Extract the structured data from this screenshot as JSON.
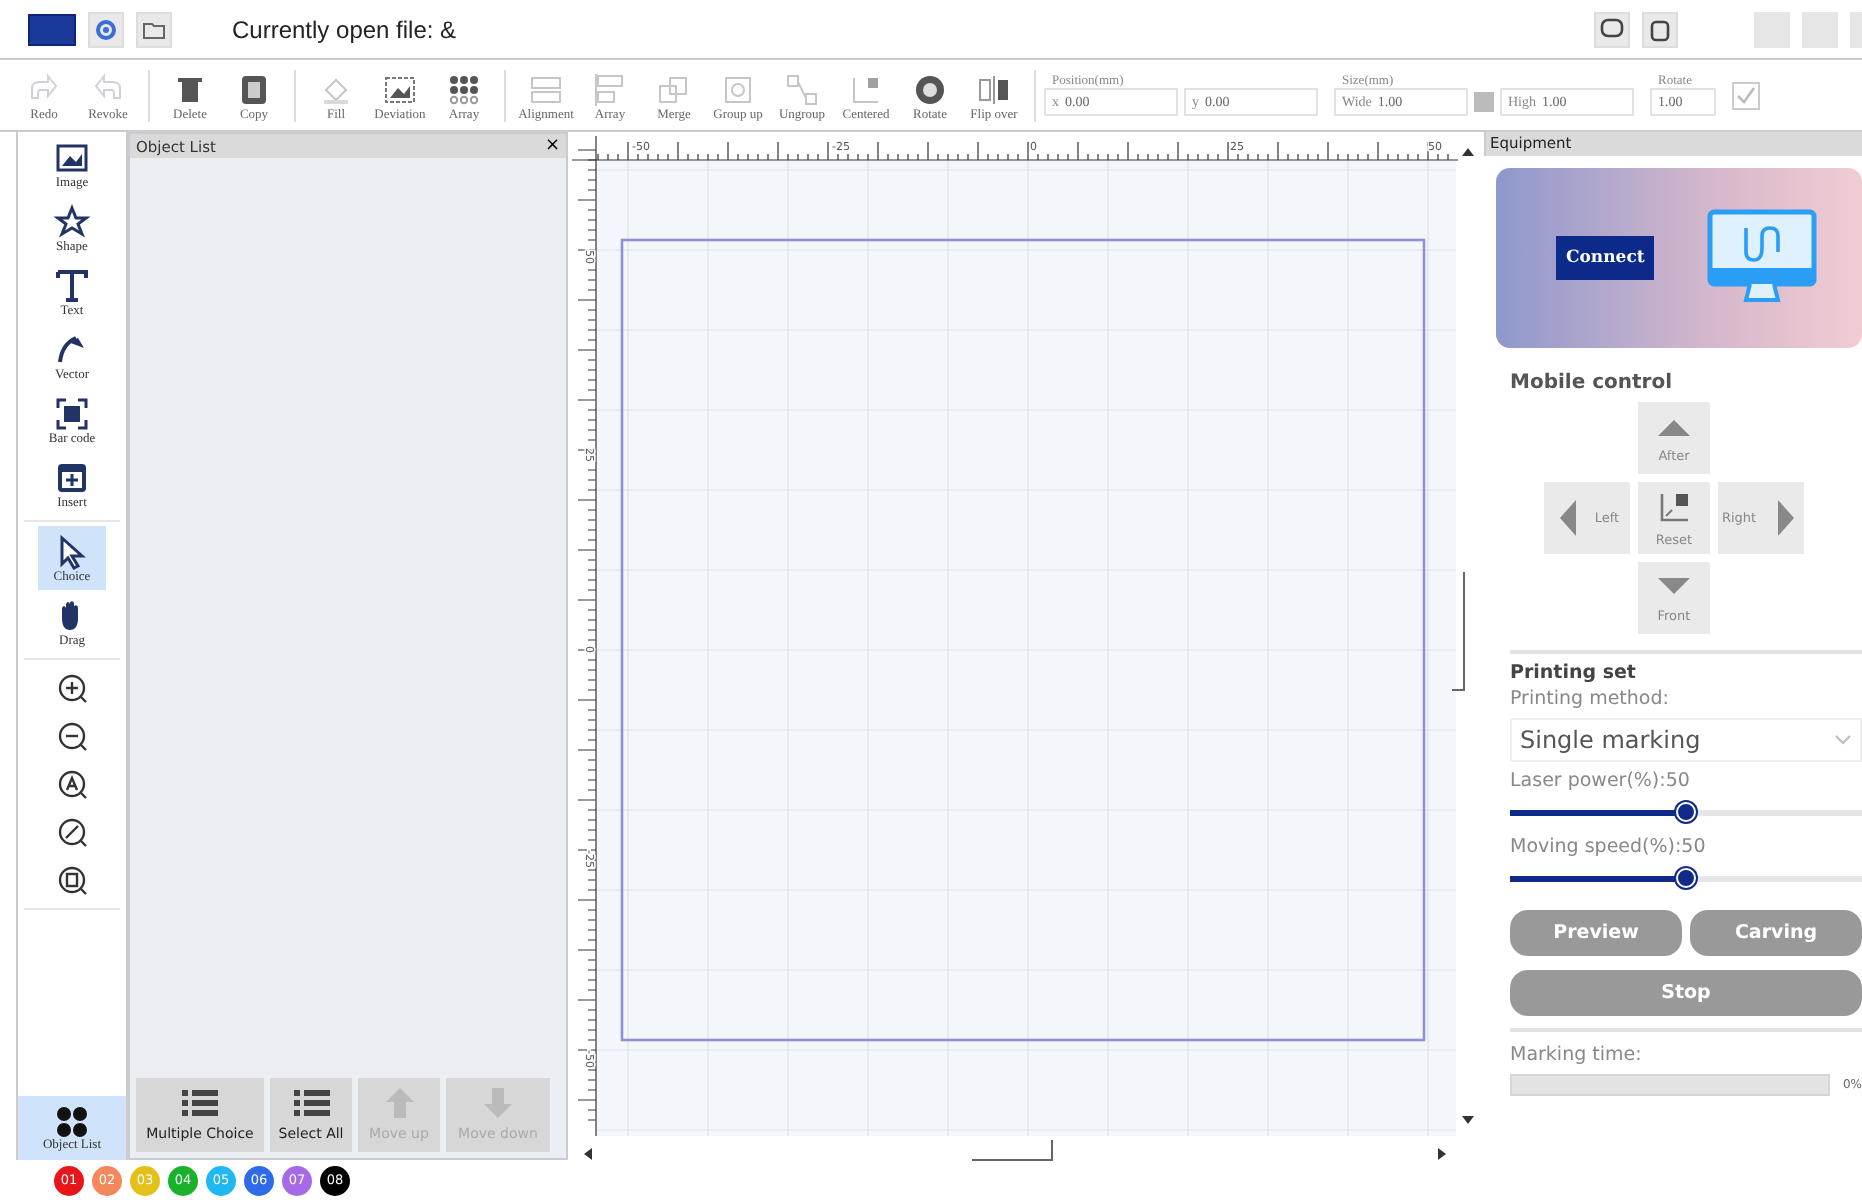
{
  "title_bar": {
    "title": "Currently open file: &"
  },
  "toolbar": {
    "groups": [
      [
        {
          "label": "Redo",
          "disabled": true
        },
        {
          "label": "Revoke",
          "disabled": true
        }
      ],
      [
        {
          "label": "Delete",
          "disabled": false
        },
        {
          "label": "Copy",
          "disabled": false
        }
      ],
      [
        {
          "label": "Fill",
          "disabled": true
        },
        {
          "label": "Deviation",
          "disabled": false
        },
        {
          "label": "Array",
          "disabled": false
        }
      ],
      [
        {
          "label": "Alignment",
          "disabled": true
        },
        {
          "label": "Array",
          "disabled": true
        },
        {
          "label": "Merge",
          "disabled": true
        },
        {
          "label": "Group up",
          "disabled": true
        },
        {
          "label": "Ungroup",
          "disabled": true
        },
        {
          "label": "Centered",
          "disabled": true
        },
        {
          "label": "Rotate",
          "disabled": false
        },
        {
          "label": "Flip over",
          "disabled": false
        }
      ]
    ],
    "position": {
      "label": "Position(mm)",
      "x_label": "x",
      "x_value": "0.00",
      "y_label": "y",
      "y_value": "0.00"
    },
    "size": {
      "label": "Size(mm)",
      "wide_label": "Wide",
      "wide_value": "1.00",
      "high_label": "High",
      "high_value": "1.00"
    },
    "rotate": {
      "label": "Rotate",
      "value": "1.00"
    },
    "lock_checkbox": {
      "checked": true
    }
  },
  "tool_panel": {
    "groups": [
      [
        {
          "label": "Image",
          "selected": false
        },
        {
          "label": "Shape",
          "selected": false
        },
        {
          "label": "Text",
          "selected": false
        },
        {
          "label": "Vector",
          "selected": false
        },
        {
          "label": "Bar code",
          "selected": false
        },
        {
          "label": "Insert",
          "selected": false
        }
      ],
      [
        {
          "label": "Choice",
          "selected": true
        },
        {
          "label": "Drag",
          "selected": false
        }
      ]
    ],
    "object_list_tab": {
      "label": "Object List",
      "selected": true
    }
  },
  "object_list": {
    "title": "Object List",
    "close": "×",
    "buttons": [
      {
        "label": "Multiple Choice",
        "disabled": false
      },
      {
        "label": "Select All",
        "disabled": false
      },
      {
        "label": "Move up",
        "disabled": true
      },
      {
        "label": "Move down",
        "disabled": true
      }
    ]
  },
  "canvas": {
    "x_ruler": [
      "-50",
      "-25",
      "0",
      "25",
      "50"
    ],
    "y_ruler": [
      "50",
      "25",
      "0",
      "-25",
      "-50"
    ]
  },
  "layers": [
    {
      "label": "01",
      "color": "#e8161b"
    },
    {
      "label": "02",
      "color": "#f4885c"
    },
    {
      "label": "03",
      "color": "#e4c11a"
    },
    {
      "label": "04",
      "color": "#18b32a"
    },
    {
      "label": "05",
      "color": "#20b8f0"
    },
    {
      "label": "06",
      "color": "#2f6ae8"
    },
    {
      "label": "07",
      "color": "#a66ae6"
    },
    {
      "label": "08",
      "color": "#000000"
    }
  ],
  "equipment": {
    "title": "Equipment",
    "connect": "Connect",
    "mobile_control": {
      "title": "Mobile control",
      "buttons": [
        {
          "kind": "up",
          "label": "After"
        },
        {
          "kind": "left",
          "label": "Left"
        },
        {
          "kind": "reset",
          "label": "Reset"
        },
        {
          "kind": "right",
          "label": "Right"
        },
        {
          "kind": "down",
          "label": "Front"
        }
      ]
    },
    "printing": {
      "title": "Printing set",
      "method_label": "Printing method:",
      "method": "Single marking",
      "sliders": [
        {
          "label": "Laser power(%):50",
          "level": 0.5
        },
        {
          "label": "Moving speed(%):50",
          "level": 0.5
        }
      ],
      "buttons": [
        {
          "kind": "half",
          "label": "Preview"
        },
        {
          "kind": "half",
          "label": "Carving"
        },
        {
          "kind": "full",
          "label": "Stop"
        }
      ],
      "time_label": "Marking time:",
      "progress": {
        "level": 0,
        "reading": "0%"
      }
    }
  }
}
